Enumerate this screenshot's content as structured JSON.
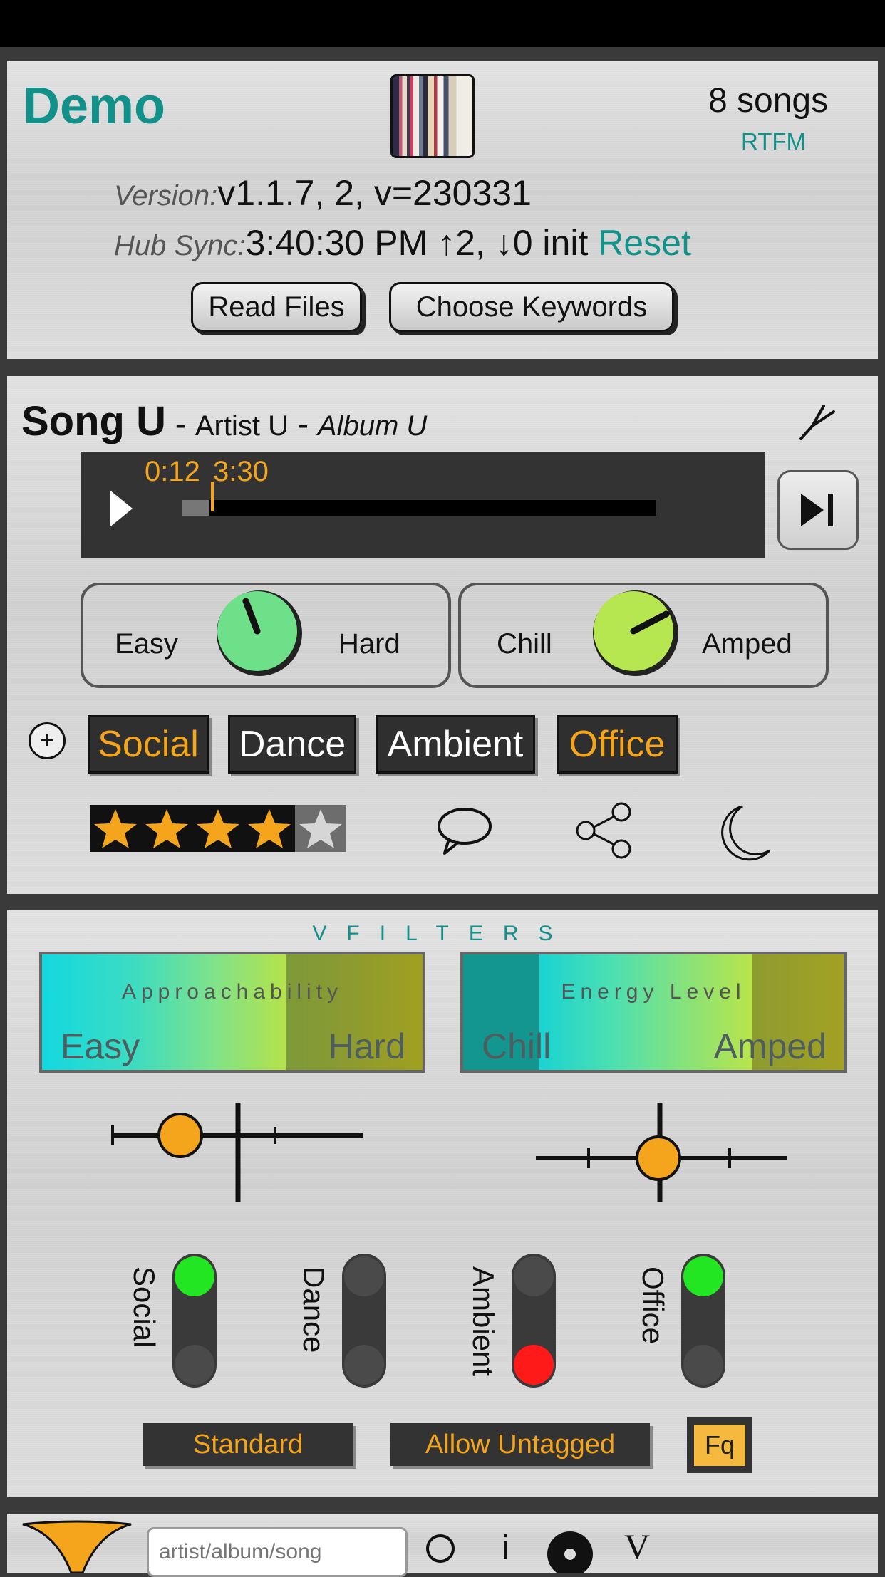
{
  "header": {
    "app_title": "Demo",
    "songs_count": "8 songs",
    "rtfm": "RTFM",
    "version_label": "Version:",
    "version_value": "v1.1.7, 2, v=230331",
    "sync_label": "Hub Sync:",
    "sync_value": "3:40:30 PM ↑2, ↓0 init",
    "reset": "Reset",
    "read_files": "Read Files",
    "choose_keywords": "Choose Keywords"
  },
  "player": {
    "song": "Song U",
    "sep1": " - ",
    "artist": "Artist U",
    "sep2": " - ",
    "album": "Album U",
    "time_current": "0:12",
    "time_total": "3:30",
    "progress": 0.057,
    "dials": [
      {
        "left": "Easy",
        "right": "Hard",
        "color": "#6ee08a"
      },
      {
        "left": "Chill",
        "right": "Amped",
        "color": "#b6e650"
      }
    ],
    "tags": [
      {
        "label": "Social",
        "active": true
      },
      {
        "label": "Dance",
        "active": false
      },
      {
        "label": "Ambient",
        "active": false
      },
      {
        "label": "Office",
        "active": true
      }
    ],
    "rating": 4,
    "rating_max": 5
  },
  "filters": {
    "title": "VFILTERS",
    "cards": [
      {
        "title": "Approachability",
        "left": "Easy",
        "right": "Hard"
      },
      {
        "title": "Energy Level",
        "left": "Chill",
        "right": "Amped"
      }
    ],
    "toggles": [
      {
        "label": "Social",
        "state": "on"
      },
      {
        "label": "Dance",
        "state": "neutral"
      },
      {
        "label": "Ambient",
        "state": "off"
      },
      {
        "label": "Office",
        "state": "on"
      }
    ],
    "standard": "Standard",
    "allow_untagged": "Allow Untagged",
    "fq": "Fq"
  },
  "search": {
    "placeholder": "artist/album/song",
    "info_icon": "i",
    "v_label": "V"
  },
  "colors": {
    "accent": "#12908a",
    "orange": "#f5a51c",
    "lamp_green": "#22e622",
    "lamp_red": "#ff1a1a"
  }
}
